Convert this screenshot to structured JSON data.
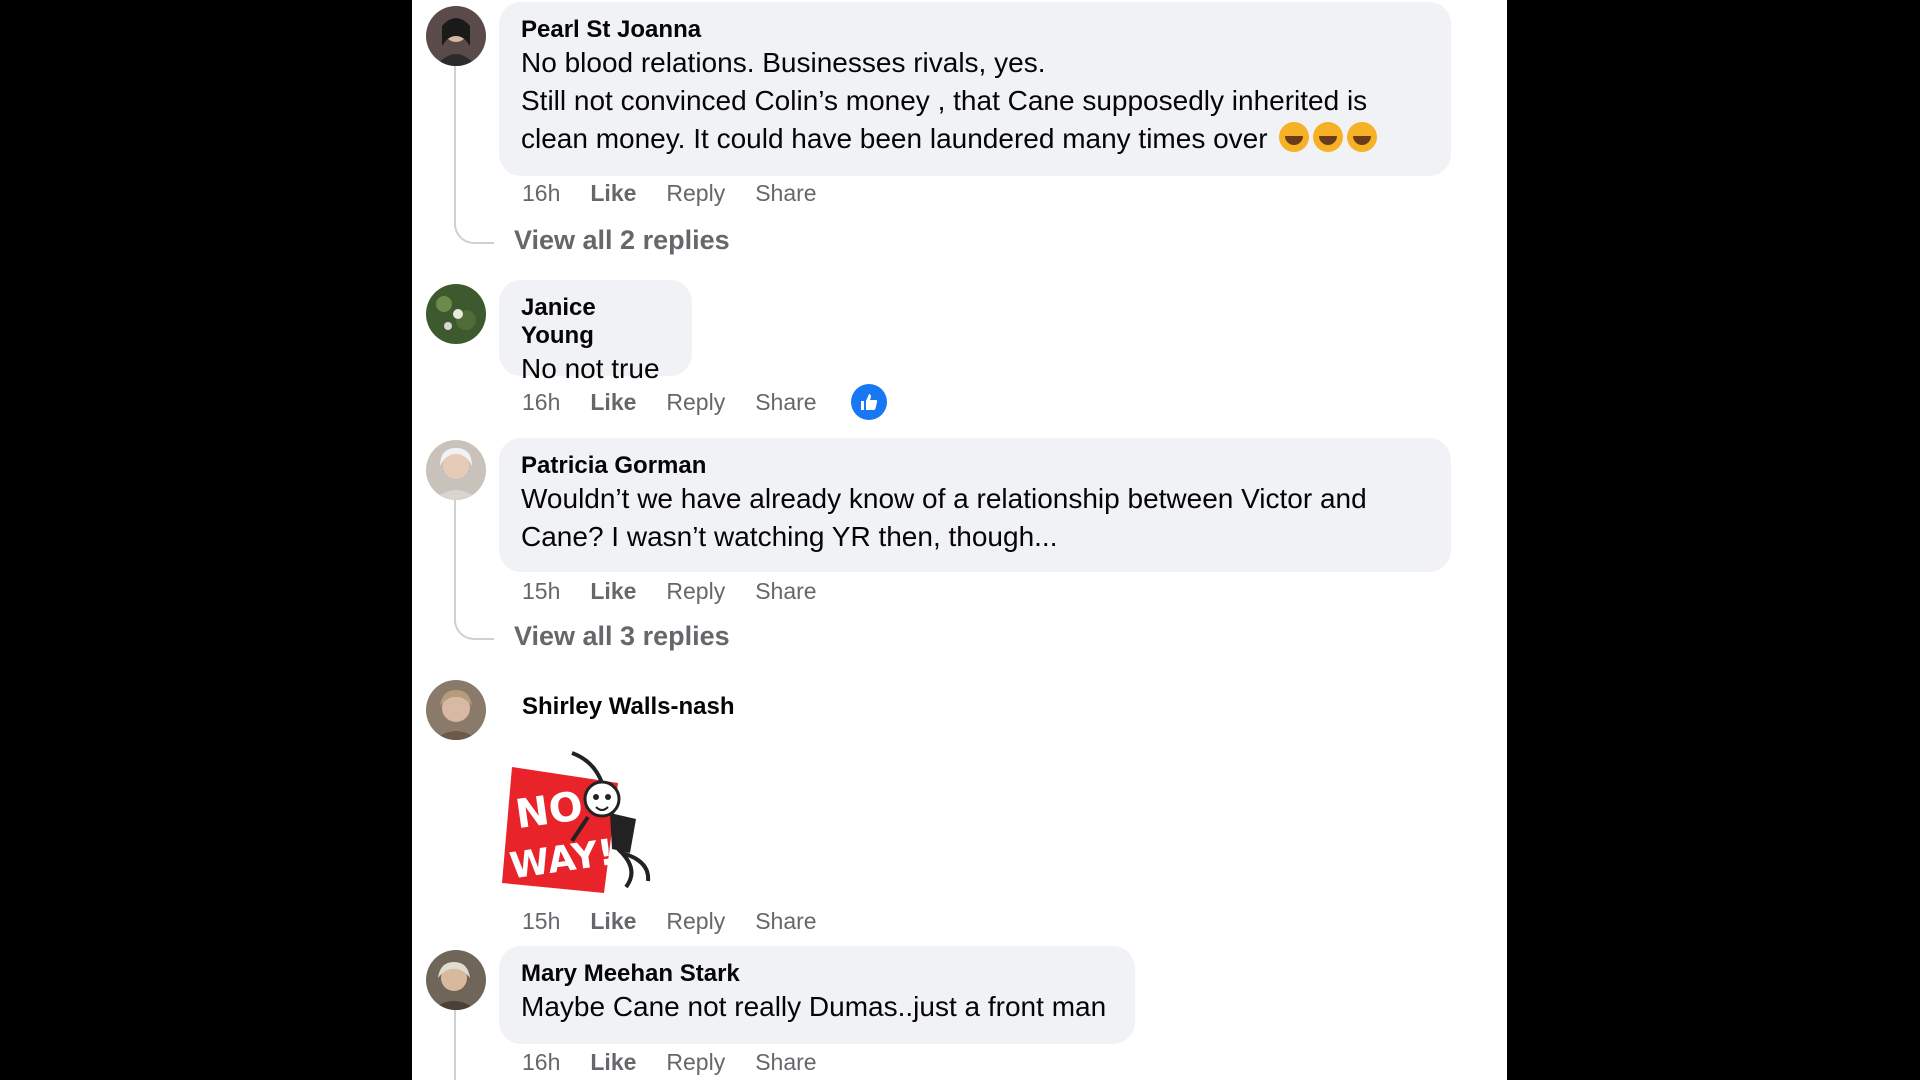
{
  "comments": [
    {
      "author": "Pearl St Joanna",
      "lines": [
        "No blood relations. Businesses rivals, yes.",
        "Still not convinced Colin’s money , that Cane supposedly inherited is",
        "clean money. It could have been laundered many times over"
      ],
      "emojis": [
        "laughing-tears-emoji",
        "laughing-tears-emoji",
        "laughing-tears-emoji"
      ],
      "time": "16h",
      "view_replies": "View all 2 replies"
    },
    {
      "author": "Janice Young",
      "lines": [
        "No not true"
      ],
      "time": "16h",
      "reaction": "like-reaction-icon"
    },
    {
      "author": "Patricia Gorman",
      "lines": [
        "Wouldn’t we have already know of a relationship between Victor and",
        "Cane? I wasn’t watching YR then, though..."
      ],
      "time": "15h",
      "view_replies": "View all 3 replies"
    },
    {
      "author": "Shirley Walls-nash",
      "sticker_text": [
        "NO",
        "WAY!"
      ],
      "time": "15h"
    },
    {
      "author": "Mary Meehan Stark",
      "lines": [
        "Maybe Cane not really Dumas..just a front man"
      ],
      "time": "16h"
    }
  ],
  "actions": {
    "like": "Like",
    "reply": "Reply",
    "share": "Share"
  },
  "colors": {
    "bubble": "#f0f2f5",
    "muted": "#65676b",
    "like_blue": "#1877f2",
    "sticker_red": "#e8242a"
  }
}
